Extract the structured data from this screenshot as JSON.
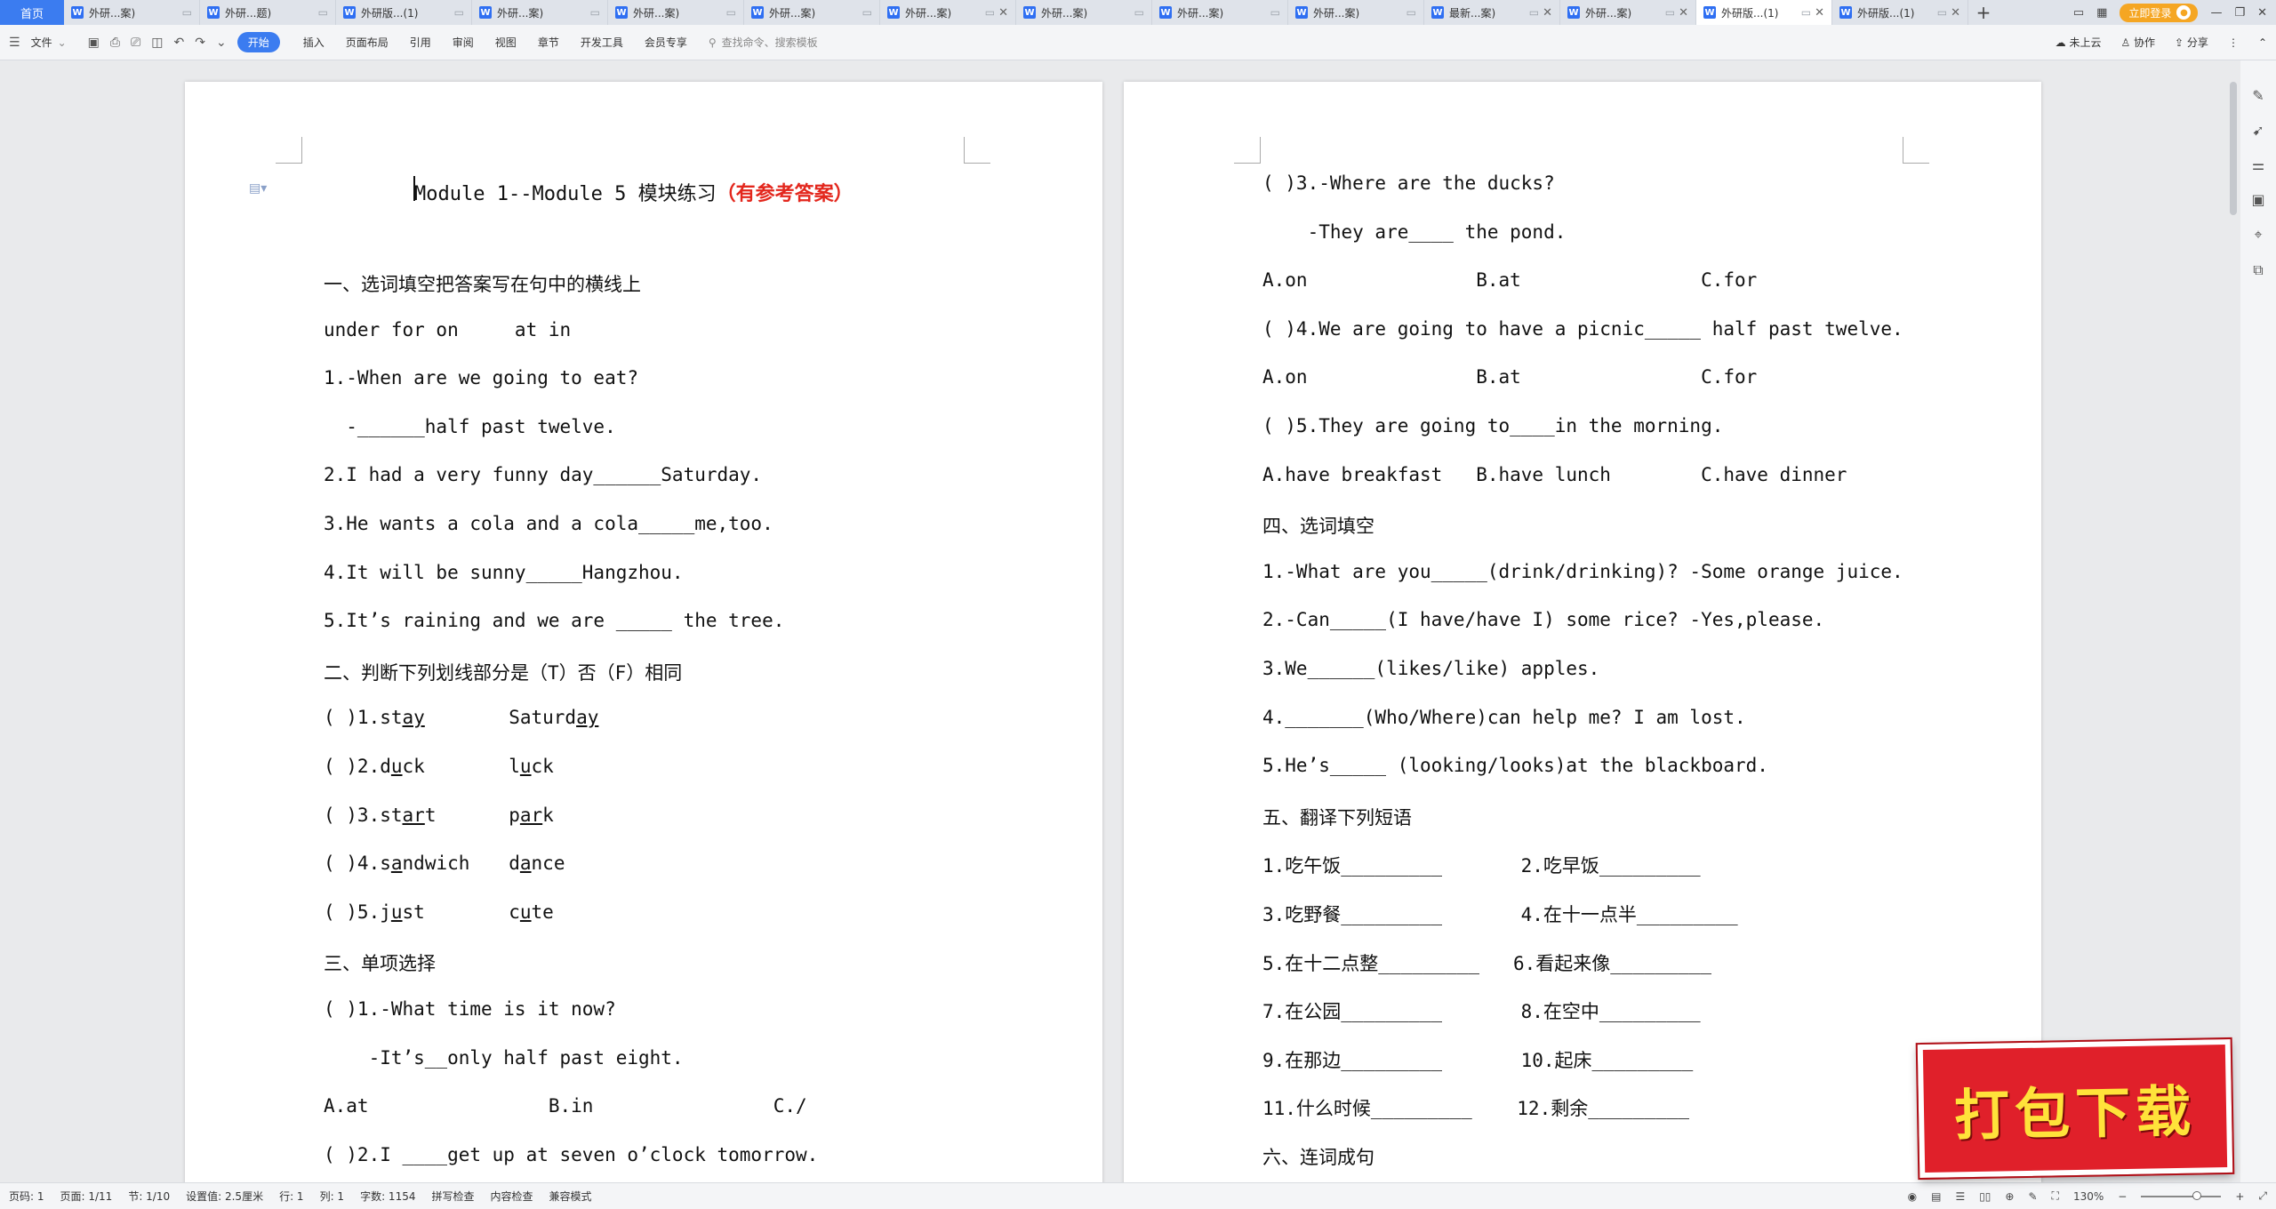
{
  "tabs": {
    "home": "首页",
    "docs": [
      {
        "label": "外研...案)",
        "active": false,
        "close": false
      },
      {
        "label": "外研...题)",
        "active": false,
        "close": false
      },
      {
        "label": "外研版...(1)",
        "active": false,
        "close": false
      },
      {
        "label": "外研...案)",
        "active": false,
        "close": false
      },
      {
        "label": "外研...案)",
        "active": false,
        "close": false
      },
      {
        "label": "外研...案)",
        "active": false,
        "close": false
      },
      {
        "label": "外研...案)",
        "active": false,
        "close": true
      },
      {
        "label": "外研...案)",
        "active": false,
        "close": false
      },
      {
        "label": "外研...案)",
        "active": false,
        "close": false
      },
      {
        "label": "外研...案)",
        "active": false,
        "close": false
      },
      {
        "label": "最新...案)",
        "active": false,
        "close": true
      },
      {
        "label": "外研...案)",
        "active": false,
        "close": true
      },
      {
        "label": "外研版...(1)",
        "active": true,
        "close": true
      },
      {
        "label": "外研版...(1)",
        "active": false,
        "close": true
      }
    ],
    "login": "立即登录"
  },
  "ribbon": {
    "file": "文件",
    "start": "开始",
    "menus": [
      "插入",
      "页面布局",
      "引用",
      "审阅",
      "视图",
      "章节",
      "开发工具",
      "会员专享"
    ],
    "search_placeholder": "查找命令、搜索模板",
    "cloud": "未上云",
    "collab": "协作",
    "share": "分享"
  },
  "page1": {
    "title_plain": "Module 1--Module 5 模块练习",
    "title_red": "（有参考答案）",
    "lines": [
      "一、选词填空把答案写在句中的横线上",
      "under for on     at in",
      "1.-When are we going to eat?",
      "  -______half past twelve.",
      "2.I had a very funny day______Saturday.",
      "3.He wants a cola and a cola_____me,too.",
      "4.It will be sunny_____Hangzhou.",
      "5.It’s raining and we are _____ the tree.",
      "二、判断下列划线部分是（T）否（F）相同"
    ],
    "pairs": [
      {
        "num": "( )1.",
        "a_pre": "st",
        "a_u": "ay",
        "a_post": "",
        "b_pre": "Saturd",
        "b_u": "ay",
        "b_post": ""
      },
      {
        "num": "( )2.",
        "a_pre": "d",
        "a_u": "u",
        "a_post": "ck",
        "b_pre": "l",
        "b_u": "u",
        "b_post": "ck"
      },
      {
        "num": "( )3.",
        "a_pre": "st",
        "a_u": "ar",
        "a_post": "t",
        "b_pre": "p",
        "b_u": "ar",
        "b_post": "k"
      },
      {
        "num": "( )4.",
        "a_pre": "s",
        "a_u": "a",
        "a_post": "ndwich",
        "b_pre": "d",
        "b_u": "a",
        "b_post": "nce"
      },
      {
        "num": "( )5.",
        "a_pre": "j",
        "a_u": "u",
        "a_post": "st",
        "b_pre": "c",
        "b_u": "u",
        "b_post": "te"
      }
    ],
    "lines2": [
      "三、单项选择",
      "( )1.-What time is it now?",
      "    -It’s__only half past eight.",
      "A.at                B.in                C./",
      "( )2.I ____get up at seven o’clock tomorrow."
    ]
  },
  "page2": {
    "lines": [
      "( )3.-Where are the ducks?",
      "    -They are____ the pond.",
      "A.on               B.at                C.for",
      "( )4.We are going to have a picnic_____ half past twelve.",
      "A.on               B.at                C.for",
      "( )5.They are going to____in the morning.",
      "A.have breakfast   B.have lunch        C.have dinner",
      "四、选词填空",
      "1.-What are you_____(drink/drinking)? -Some orange juice.",
      "2.-Can_____(I have/have I) some rice? -Yes,please.",
      "3.We______(likes/like) apples.",
      "4._______(Who/Where)can help me? I am lost.",
      "5.He’s_____ (looking/looks)at the blackboard.",
      "五、翻译下列短语",
      "1.吃午饭_________       2.吃早饭_________",
      "3.吃野餐_________       4.在十一点半_________",
      "5.在十二点整_________   6.看起来像_________",
      "7.在公园_________       8.在空中_________",
      "9.在那边_________       10.起床_________",
      "11.什么时候_________    12.剩余_________",
      "六、连词成句"
    ]
  },
  "status": {
    "items": [
      "页码: 1",
      "页面: 1/11",
      "节: 1/10",
      "设置值: 2.5厘米",
      "行: 1",
      "列: 1",
      "字数: 1154",
      "拼写检查",
      "内容检查",
      "兼容模式"
    ],
    "zoom": "130%"
  },
  "stamp_text": "打包下载"
}
